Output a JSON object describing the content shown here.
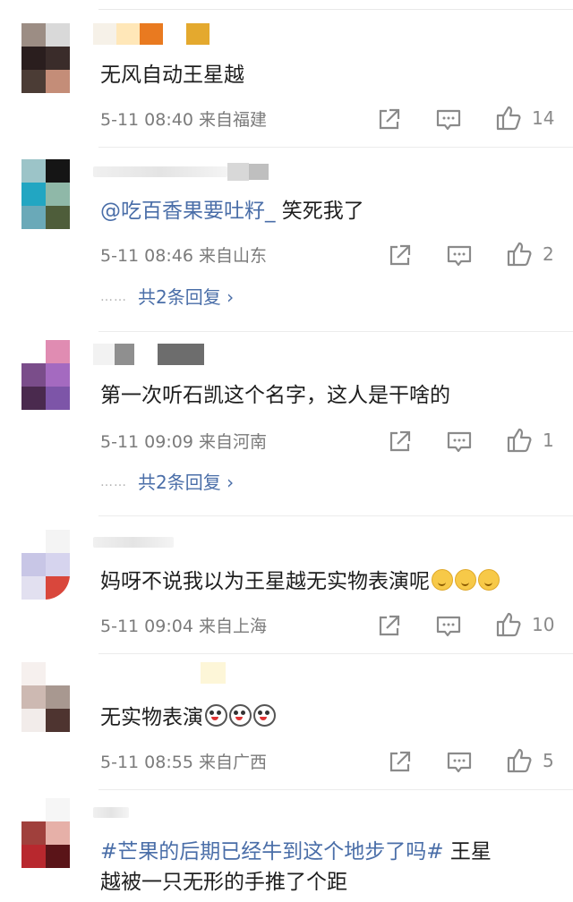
{
  "colors": {
    "link": "#4a6ea8",
    "meta": "#7b7b7b",
    "text": "#1e1e1e"
  },
  "comments": [
    {
      "text": "无风自动王星越",
      "time": "5-11 08:40",
      "location": "来自福建",
      "likes": "14"
    },
    {
      "mention": "@吃百香果要吐籽_",
      "text": " 笑死我了",
      "time": "5-11 08:46",
      "location": "来自山东",
      "likes": "2",
      "replies": "共2条回复 ›",
      "dots": "……"
    },
    {
      "text": "第一次听石凯这个名字，这人是干啥的",
      "time": "5-11 09:09",
      "location": "来自河南",
      "likes": "1",
      "replies": "共2条回复 ›",
      "dots": "……"
    },
    {
      "text": "妈呀不说我以为王星越无实物表演呢",
      "emoji": "upside-down-face-emoji",
      "time": "5-11 09:04",
      "location": "来自上海",
      "likes": "10"
    },
    {
      "text": "无实物表演",
      "emoji": "crazy-face-emoji",
      "time": "5-11 08:55",
      "location": "来自广西",
      "likes": "5"
    },
    {
      "topic": "#芒果的后期已经牛到这个地步了吗#",
      "text_line1": " 王星",
      "text_line2": "越被一只无形的手推了个距"
    }
  ],
  "icons": {
    "share": "share-icon",
    "comment": "comment-icon",
    "like": "thumbs-up-icon"
  }
}
